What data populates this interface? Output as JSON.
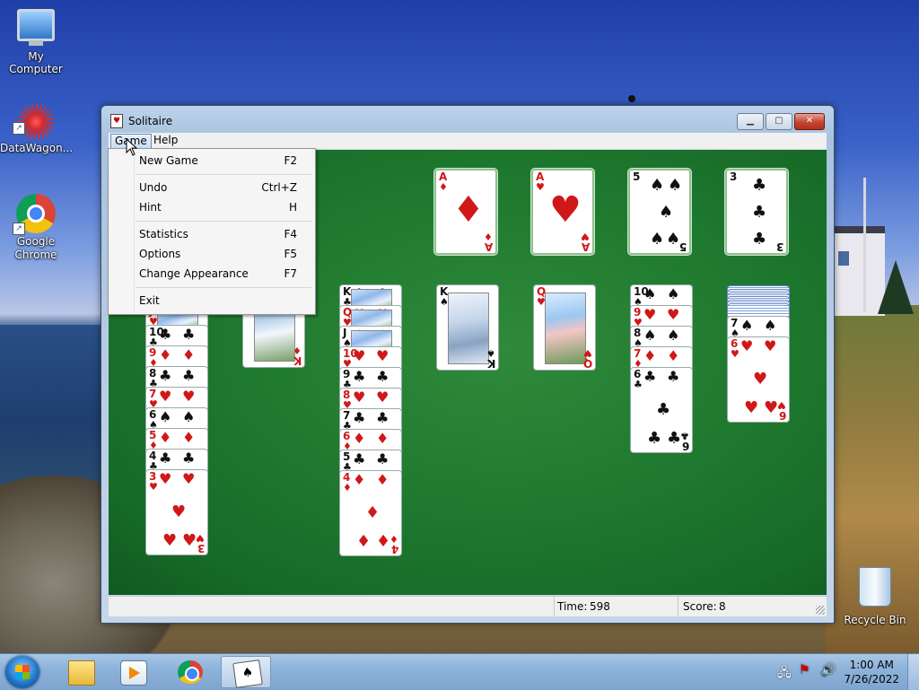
{
  "desktop": {
    "icons": [
      {
        "label": "My Computer",
        "icon": "computer-icon"
      },
      {
        "label": "DataWagon...",
        "icon": "datawagon-icon"
      },
      {
        "label": "Google\nChrome",
        "icon": "chrome-icon"
      },
      {
        "label": "Recycle Bin",
        "icon": "recycle-bin-icon"
      }
    ]
  },
  "window": {
    "title": "Solitaire",
    "menubar": {
      "game": "Game",
      "help": "Help"
    },
    "status": {
      "time_label": "Time:",
      "time_value": "598",
      "score_label": "Score:",
      "score_value": "8"
    }
  },
  "game_menu": {
    "items": [
      {
        "label": "New Game",
        "shortcut": "F2"
      },
      {
        "label": "Undo",
        "shortcut": "Ctrl+Z"
      },
      {
        "label": "Hint",
        "shortcut": "H"
      },
      {
        "label": "Statistics",
        "shortcut": "F4"
      },
      {
        "label": "Options",
        "shortcut": "F5"
      },
      {
        "label": "Change Appearance",
        "shortcut": "F7"
      },
      {
        "label": "Exit",
        "shortcut": ""
      }
    ]
  },
  "foundations": [
    {
      "rank": "A",
      "suit": "♦",
      "color": "red"
    },
    {
      "rank": "A",
      "suit": "♥",
      "color": "red"
    },
    {
      "rank": "5",
      "suit": "♠",
      "color": "black"
    },
    {
      "rank": "3",
      "suit": "♣",
      "color": "black"
    }
  ],
  "tableau": {
    "col1": [
      {
        "rank": "J",
        "suit": "♥",
        "color": "red",
        "face": true
      },
      {
        "rank": "10",
        "suit": "♣",
        "color": "black"
      },
      {
        "rank": "9",
        "suit": "♦",
        "color": "red"
      },
      {
        "rank": "8",
        "suit": "♣",
        "color": "black"
      },
      {
        "rank": "7",
        "suit": "♥",
        "color": "red"
      },
      {
        "rank": "6",
        "suit": "♠",
        "color": "black"
      },
      {
        "rank": "5",
        "suit": "♦",
        "color": "red"
      },
      {
        "rank": "4",
        "suit": "♣",
        "color": "black"
      },
      {
        "rank": "3",
        "suit": "♥",
        "color": "red"
      }
    ],
    "col2": [
      {
        "rank": "K",
        "suit": "♦",
        "color": "red"
      }
    ],
    "col3": [
      {
        "rank": "K",
        "suit": "♣",
        "color": "black",
        "face": true
      },
      {
        "rank": "Q",
        "suit": "♥",
        "color": "red",
        "face": true
      },
      {
        "rank": "J",
        "suit": "♠",
        "color": "black",
        "face": true
      },
      {
        "rank": "10",
        "suit": "♥",
        "color": "red"
      },
      {
        "rank": "9",
        "suit": "♣",
        "color": "black"
      },
      {
        "rank": "8",
        "suit": "♥",
        "color": "red"
      },
      {
        "rank": "7",
        "suit": "♣",
        "color": "black"
      },
      {
        "rank": "6",
        "suit": "♦",
        "color": "red"
      },
      {
        "rank": "5",
        "suit": "♣",
        "color": "black"
      },
      {
        "rank": "4",
        "suit": "♦",
        "color": "red"
      }
    ],
    "col4": [
      {
        "rank": "K",
        "suit": "♠",
        "color": "black"
      }
    ],
    "col5": [
      {
        "rank": "Q",
        "suit": "♥",
        "color": "red"
      }
    ],
    "col6": [
      {
        "rank": "10",
        "suit": "♠",
        "color": "black"
      },
      {
        "rank": "9",
        "suit": "♥",
        "color": "red"
      },
      {
        "rank": "8",
        "suit": "♠",
        "color": "black"
      },
      {
        "rank": "7",
        "suit": "♦",
        "color": "red"
      },
      {
        "rank": "6",
        "suit": "♣",
        "color": "black"
      }
    ],
    "col7": [
      {
        "rank": "7",
        "suit": "♠",
        "color": "black"
      },
      {
        "rank": "6",
        "suit": "♥",
        "color": "red"
      }
    ]
  },
  "taskbar": {
    "pinned": [
      "folder-icon",
      "media-player-icon",
      "chrome-icon",
      "solitaire-icon"
    ],
    "clock_time": "1:00 AM",
    "clock_date": "7/26/2022"
  },
  "colors": {
    "felt": "#1f7a30",
    "red_suit": "#d01818",
    "black_suit": "#111111"
  }
}
